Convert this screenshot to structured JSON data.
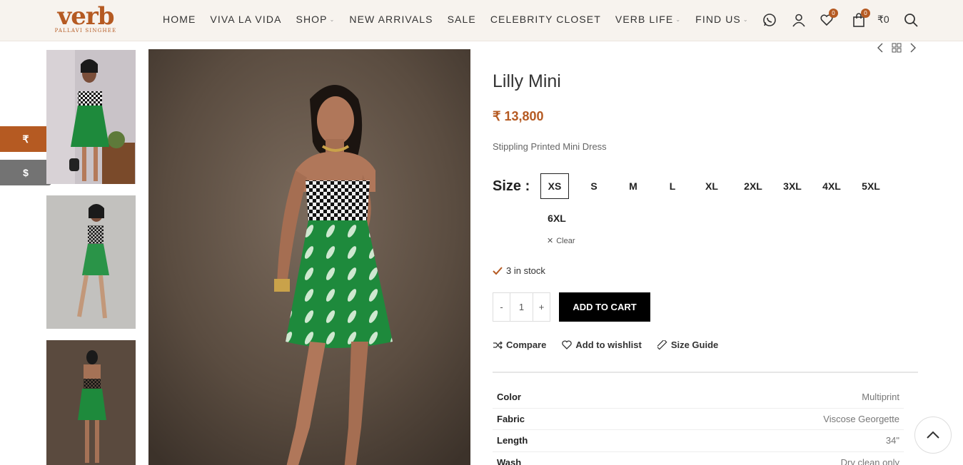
{
  "brand": {
    "name": "verb",
    "tagline": "PALLAVI SINGHEE",
    "color": "#b55a22"
  },
  "nav": [
    {
      "label": "HOME",
      "dropdown": false
    },
    {
      "label": "VIVA LA VIDA",
      "dropdown": false
    },
    {
      "label": "SHOP",
      "dropdown": true
    },
    {
      "label": "NEW ARRIVALS",
      "dropdown": false
    },
    {
      "label": "SALE",
      "dropdown": false
    },
    {
      "label": "CELEBRITY CLOSET",
      "dropdown": false
    },
    {
      "label": "VERB LIFE",
      "dropdown": true
    },
    {
      "label": "FIND US",
      "dropdown": true
    }
  ],
  "header": {
    "icons": [
      "whatsapp-icon",
      "user-icon",
      "heart-icon",
      "bag-icon",
      "search-icon"
    ],
    "wishlist_count": "0",
    "cart_count": "0",
    "cart_total": "₹0"
  },
  "currency": {
    "inr": "₹",
    "usd": "$"
  },
  "product": {
    "title": "Lilly Mini",
    "price": "₹ 13,800",
    "description": "Stippling Printed Mini Dress",
    "size_label": "Size :",
    "sizes": [
      "XS",
      "S",
      "M",
      "L",
      "XL",
      "2XL",
      "3XL",
      "4XL",
      "5XL",
      "6XL"
    ],
    "selected_size": "XS",
    "clear_label": "Clear",
    "stock": "3 in stock",
    "quantity": "1",
    "qty_minus": "-",
    "qty_plus": "+",
    "add_to_cart": "ADD TO CART",
    "actions": {
      "compare": "Compare",
      "wishlist": "Add to wishlist",
      "size_guide": "Size Guide"
    },
    "attributes": [
      {
        "key": "Color",
        "value": "Multiprint"
      },
      {
        "key": "Fabric",
        "value": "Viscose Georgette"
      },
      {
        "key": "Length",
        "value": "34\""
      },
      {
        "key": "Wash",
        "value": "Dry clean only"
      }
    ]
  },
  "colors": {
    "accent": "#b55a22",
    "button": "#000000",
    "dress_green": "#1e8a3c"
  }
}
